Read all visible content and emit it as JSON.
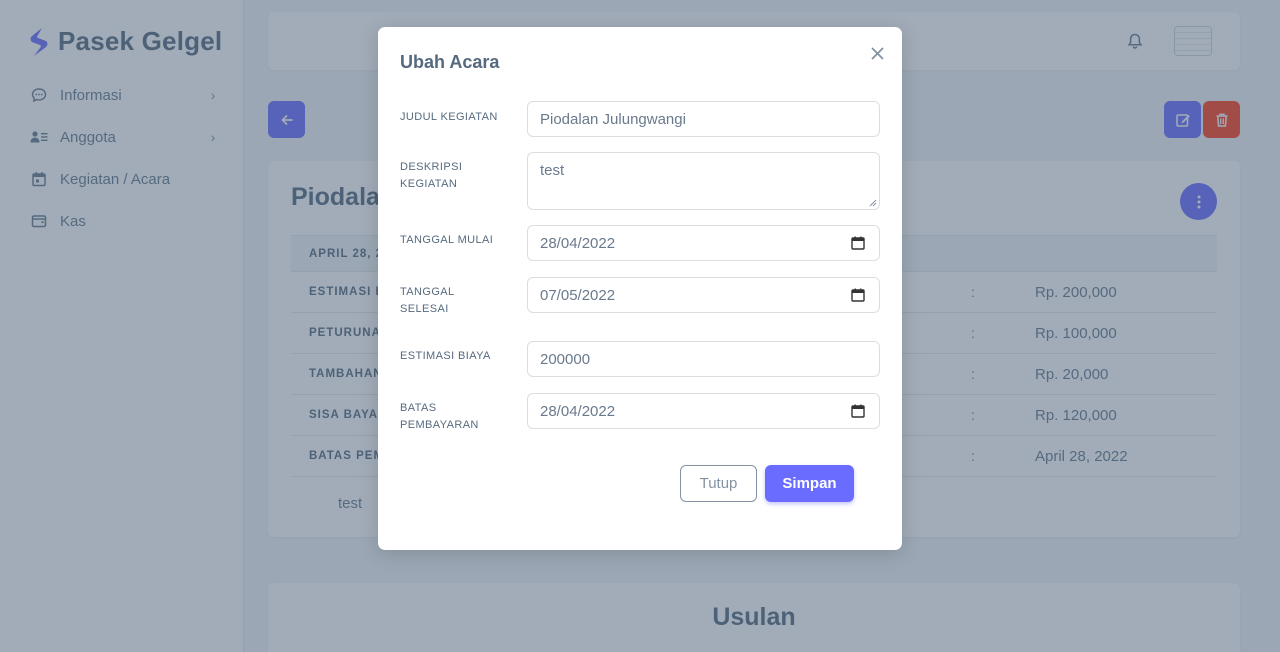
{
  "brand": {
    "name": "Pasek Gelgel"
  },
  "sidebar": {
    "items": [
      {
        "label": "Informasi",
        "icon": "chat-icon",
        "has_submenu": true
      },
      {
        "label": "Anggota",
        "icon": "users-icon",
        "has_submenu": true
      },
      {
        "label": "Kegiatan / Acara",
        "icon": "calendar-icon",
        "has_submenu": false
      },
      {
        "label": "Kas",
        "icon": "wallet-icon",
        "has_submenu": false
      }
    ]
  },
  "detail": {
    "title": "Piodala",
    "date_header": "APRIL 28, 2",
    "rows": [
      {
        "label": "ESTIMASI B",
        "colon": ":",
        "value": "Rp. 200,000"
      },
      {
        "label": "PETURUNA",
        "colon": ":",
        "value": "Rp. 100,000"
      },
      {
        "label": "TAMBAHAN",
        "colon": ":",
        "value": "Rp. 20,000"
      },
      {
        "label": "SISA BAYA",
        "colon": ":",
        "value": "Rp. 120,000"
      },
      {
        "label": "BATAS PEM",
        "colon": ":",
        "value": "April 28, 2022"
      }
    ],
    "description": "test"
  },
  "usulan": {
    "title": "Usulan"
  },
  "modal": {
    "title": "Ubah Acara",
    "fields": {
      "judul": {
        "label": "JUDUL KEGIATAN",
        "value": "Piodalan Julungwangi"
      },
      "deskripsi": {
        "label_line1": "DESKRIPSI",
        "label_line2": "KEGIATAN",
        "value": "test"
      },
      "tanggal_mulai": {
        "label": "TANGGAL MULAI",
        "value": "28/04/2022"
      },
      "tanggal_selesai": {
        "label_line1": "TANGGAL",
        "label_line2": "SELESAI",
        "value": "07/05/2022"
      },
      "estimasi_biaya": {
        "label": "ESTIMASI BIAYA",
        "value": "200000"
      },
      "batas_pembayaran": {
        "label_line1": "BATAS",
        "label_line2": "PEMBAYARAN",
        "value": "28/04/2022"
      }
    },
    "buttons": {
      "close": "Tutup",
      "save": "Simpan"
    }
  },
  "colors": {
    "primary": "#696cff",
    "danger": "#ff3e1d",
    "text": "#566a7f",
    "backdrop": "rgba(67, 89, 113, 0.5)"
  }
}
